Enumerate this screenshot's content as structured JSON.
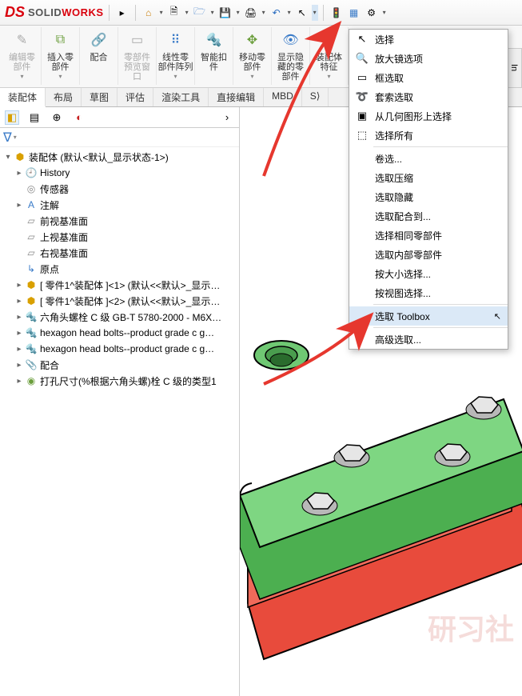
{
  "app": {
    "brand_ds": "DS",
    "brand_solid": "SOLID",
    "brand_works": "WORKS"
  },
  "ribbon": {
    "items": [
      {
        "label": "编辑零\n部件"
      },
      {
        "label": "插入零\n部件"
      },
      {
        "label": "配合"
      },
      {
        "label": "零部件\n预览窗\n口"
      },
      {
        "label": "线性零\n部件阵列"
      },
      {
        "label": "智能扣\n件"
      },
      {
        "label": "移动零\n部件"
      },
      {
        "label": "显示隐\n藏的零\n部件"
      },
      {
        "label": "装配体\n特征"
      }
    ]
  },
  "tabs": {
    "items": [
      "装配体",
      "布局",
      "草图",
      "评估",
      "渲染工具",
      "直接编辑",
      "MBD",
      "S⟩"
    ]
  },
  "side_btn": "In",
  "tree": {
    "root": "装配体 (默认<默认_显示状态-1>)",
    "history": "History",
    "sensors": "传感器",
    "annotations": "注解",
    "front": "前视基准面",
    "top": "上视基准面",
    "right": "右视基准面",
    "origin": "原点",
    "part1a": "[ 零件1^装配体 ]<1> (默认<<默认>_显示…",
    "part1b": "[ 零件1^装配体 ]<2> (默认<<默认>_显示…",
    "hexbolt": "六角头螺栓 C 级 GB-T 5780-2000 - M6X…",
    "hex1": "hexagon head bolts--product grade c g…",
    "hex2": "hexagon head bolts--product grade c g…",
    "mates": "配合",
    "hole": "打孔尺寸(%根据六角头螺)栓 C 级的类型1"
  },
  "menu": {
    "items": [
      "选择",
      "放大镜选项",
      "框选取",
      "套索选取",
      "从几何图形上选择",
      "选择所有",
      "卷选...",
      "选取压缩",
      "选取隐藏",
      "选取配合到...",
      "选择相同零部件",
      "选取内部零部件",
      "按大小选择...",
      "按视图选择...",
      "选取 Toolbox",
      "高级选取..."
    ]
  },
  "watermark": "研习社"
}
